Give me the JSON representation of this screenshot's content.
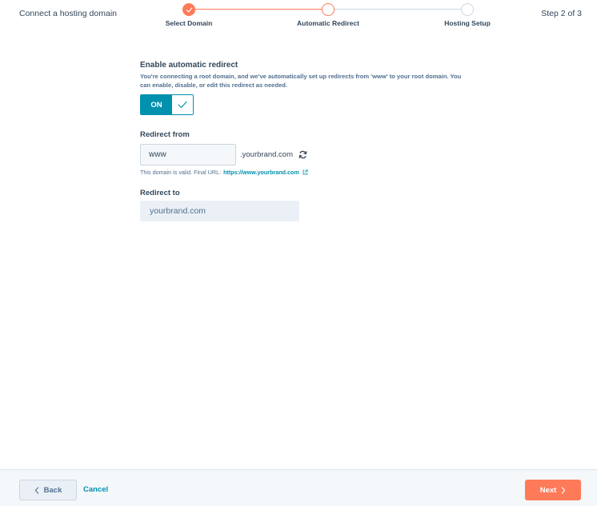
{
  "header": {
    "title": "Connect a hosting domain",
    "step_counter": "Step 2 of 3"
  },
  "stepper": {
    "steps": [
      {
        "label": "Select Domain",
        "state": "completed"
      },
      {
        "label": "Automatic Redirect",
        "state": "current"
      },
      {
        "label": "Hosting Setup",
        "state": "upcoming"
      }
    ]
  },
  "redirect": {
    "title": "Enable automatic redirect",
    "description": "You're connecting a root domain, and we've automatically set up redirects from 'www' to your root domain. You can enable, disable, or edit this redirect as needed.",
    "toggle_label": "ON"
  },
  "redirect_from": {
    "label": "Redirect from",
    "value": "www",
    "suffix": ".yourbrand.com",
    "valid_text": "This domain is valid. Final URL:",
    "final_url": "https://www.yourbrand.com"
  },
  "redirect_to": {
    "label": "Redirect to",
    "value": "yourbrand.com"
  },
  "footer": {
    "back_label": "Back",
    "cancel_label": "Cancel",
    "next_label": "Next"
  },
  "colors": {
    "accent": "#ff7a59",
    "teal": "#0091ae",
    "text": "#33475b"
  }
}
